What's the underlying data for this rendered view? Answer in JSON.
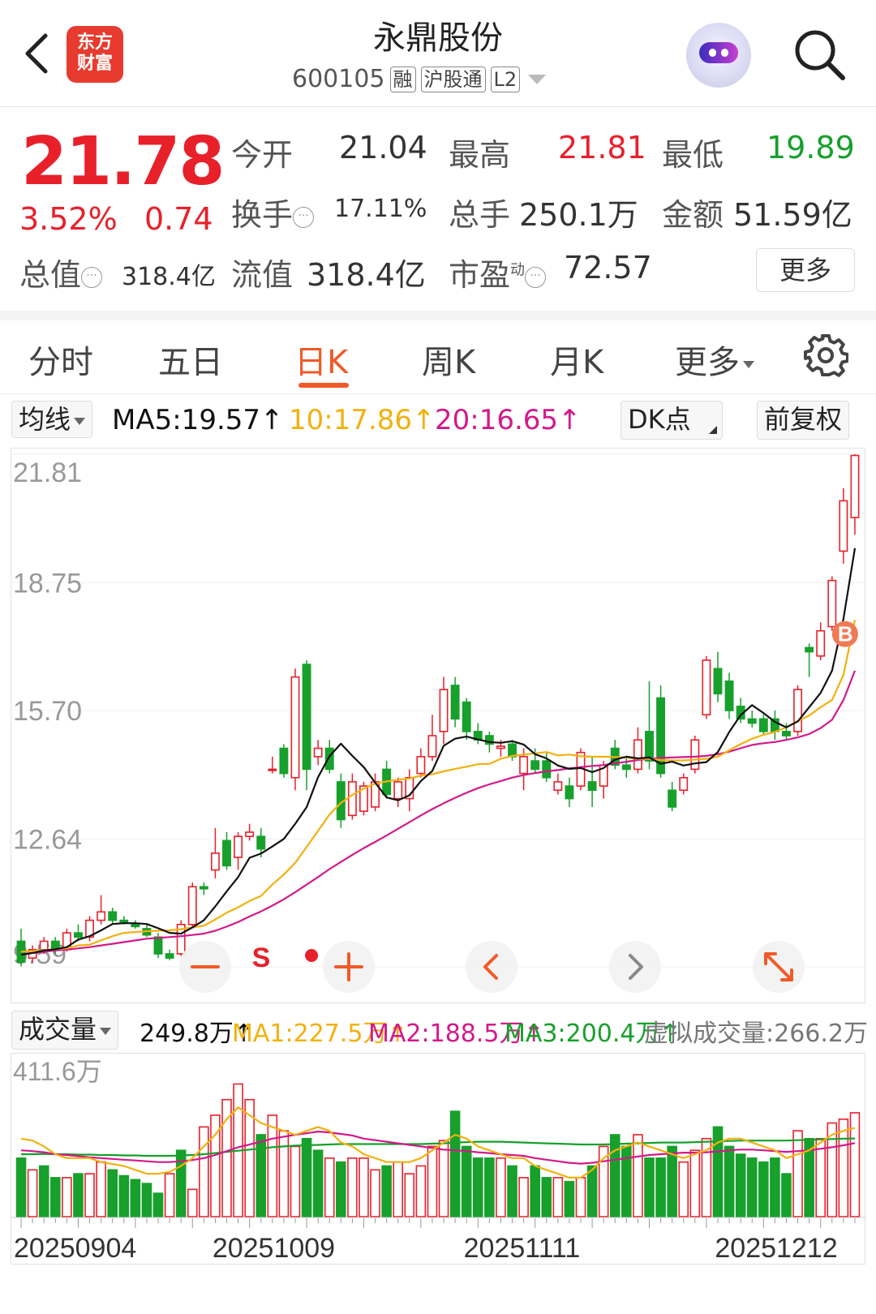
{
  "header": {
    "back_icon": "chevron-left-icon",
    "logo_line1": "东方",
    "logo_line2": "财富",
    "title": "永鼎股份",
    "code": "600105",
    "tags": [
      "融",
      "沪股通",
      "L2"
    ],
    "robot_icon": "robot-assistant-icon",
    "search_icon": "search-icon"
  },
  "quote": {
    "price": "21.78",
    "change_pct": "3.52%",
    "change_amt": "0.74",
    "open_label": "今开",
    "open": "21.04",
    "high_label": "最高",
    "high": "21.81",
    "low_label": "最低",
    "low": "19.89",
    "turnover_label": "换手",
    "turnover": "17.11%",
    "volume_label": "总手",
    "volume": "250.1万",
    "amount_label": "金额",
    "amount": "51.59亿",
    "mktcap_label": "总值",
    "mktcap": "318.4亿",
    "float_label": "流值",
    "float_cap": "318.4亿",
    "pe_label": "市盈",
    "pe_sup": "动",
    "pe": "72.57",
    "more_label": "更多"
  },
  "tabs": [
    "分时",
    "五日",
    "日K",
    "周K",
    "月K",
    "更多"
  ],
  "active_tab": "日K",
  "ma_bar": {
    "dropdown": "均线",
    "ma5": "MA5:19.57",
    "ma10": "10:17.86",
    "ma20": "20:16.65",
    "dk_label": "DK点",
    "adjust_label": "前复权"
  },
  "volume_bar": {
    "dropdown": "成交量",
    "vol": "249.8万",
    "ma1": "MA1:227.5万",
    "ma2": "MA2:188.5万",
    "ma3": "MA3:200.4万",
    "virtual": "虚拟成交量:266.2万"
  },
  "colors": {
    "up": "#e8202a",
    "down": "#17a02b",
    "ma5": "#111111",
    "ma10": "#f2b10f",
    "ma20": "#d21a8a",
    "accent": "#f05a28"
  },
  "controls": {
    "zoom_out_icon": "minus-icon",
    "zoom_in_icon": "plus-icon",
    "prev_icon": "chevron-left-icon",
    "next_icon": "chevron-right-icon",
    "fullscreen_icon": "expand-icon"
  },
  "chart_data": [
    {
      "type": "candlestick",
      "y_ticks": [
        "21.81",
        "18.75",
        "15.70",
        "12.64",
        "9.59"
      ],
      "ylim": [
        9.59,
        21.81
      ],
      "marker_s": "S",
      "marker_b": "B",
      "candles": [
        [
          10.2,
          10.5,
          9.6,
          9.7
        ],
        [
          9.8,
          10.1,
          9.7,
          10.0
        ],
        [
          10.0,
          10.3,
          9.9,
          10.2
        ],
        [
          10.2,
          10.3,
          9.9,
          10.0
        ],
        [
          10.0,
          10.5,
          9.95,
          10.4
        ],
        [
          10.4,
          10.6,
          10.2,
          10.3
        ],
        [
          10.3,
          10.8,
          10.2,
          10.7
        ],
        [
          10.7,
          11.3,
          10.6,
          10.9
        ],
        [
          10.9,
          11.0,
          10.6,
          10.7
        ],
        [
          10.7,
          10.8,
          10.6,
          10.65
        ],
        [
          10.6,
          10.7,
          10.5,
          10.55
        ],
        [
          10.5,
          10.6,
          10.3,
          10.35
        ],
        [
          10.3,
          10.4,
          9.8,
          9.9
        ],
        [
          9.9,
          10.0,
          9.75,
          9.8
        ],
        [
          9.9,
          10.7,
          9.85,
          10.6
        ],
        [
          10.6,
          11.6,
          10.55,
          11.5
        ],
        [
          11.5,
          11.6,
          11.3,
          11.45
        ],
        [
          11.9,
          12.9,
          11.7,
          12.3
        ],
        [
          12.6,
          12.8,
          11.9,
          12.0
        ],
        [
          12.2,
          12.8,
          11.9,
          12.7
        ],
        [
          12.7,
          13.0,
          12.6,
          12.8
        ],
        [
          12.7,
          12.9,
          12.2,
          12.4
        ],
        [
          14.3,
          14.6,
          14.2,
          14.3
        ],
        [
          14.8,
          14.9,
          14.1,
          14.2
        ],
        [
          14.1,
          16.7,
          13.8,
          16.5
        ],
        [
          16.8,
          16.9,
          13.8,
          14.3
        ],
        [
          14.6,
          15.0,
          14.4,
          14.8
        ],
        [
          14.8,
          15.0,
          14.2,
          14.3
        ],
        [
          14.0,
          14.2,
          12.9,
          13.1
        ],
        [
          13.2,
          14.2,
          13.1,
          14.0
        ],
        [
          13.3,
          14.0,
          13.2,
          13.9
        ],
        [
          13.4,
          14.2,
          13.3,
          14.0
        ],
        [
          14.3,
          14.5,
          13.6,
          13.7
        ],
        [
          13.6,
          14.1,
          13.4,
          14.0
        ],
        [
          13.6,
          14.3,
          13.3,
          14.1
        ],
        [
          14.2,
          14.8,
          14.1,
          14.6
        ],
        [
          14.6,
          15.6,
          14.5,
          15.1
        ],
        [
          15.2,
          16.5,
          14.9,
          16.2
        ],
        [
          16.3,
          16.5,
          15.3,
          15.5
        ],
        [
          15.9,
          16.0,
          15.0,
          15.2
        ],
        [
          15.2,
          15.4,
          14.9,
          15.0
        ],
        [
          15.1,
          15.2,
          14.7,
          14.9
        ],
        [
          14.8,
          15.0,
          14.6,
          14.85
        ],
        [
          14.9,
          15.0,
          14.5,
          14.6
        ],
        [
          14.2,
          14.8,
          13.8,
          14.6
        ],
        [
          14.5,
          14.8,
          14.2,
          14.3
        ],
        [
          14.5,
          14.7,
          14.0,
          14.1
        ],
        [
          13.8,
          14.2,
          13.7,
          14.0
        ],
        [
          13.9,
          14.1,
          13.4,
          13.6
        ],
        [
          13.9,
          14.8,
          13.8,
          14.7
        ],
        [
          14.0,
          14.6,
          13.4,
          13.8
        ],
        [
          13.9,
          14.5,
          13.6,
          14.4
        ],
        [
          14.8,
          15.0,
          14.3,
          14.4
        ],
        [
          14.4,
          14.6,
          14.1,
          14.3
        ],
        [
          14.3,
          15.3,
          14.2,
          15.0
        ],
        [
          15.2,
          16.4,
          14.3,
          14.5
        ],
        [
          16.0,
          16.3,
          14.1,
          14.2
        ],
        [
          13.8,
          14.0,
          13.3,
          13.4
        ],
        [
          13.8,
          14.2,
          13.7,
          14.1
        ],
        [
          14.3,
          15.1,
          14.2,
          15.0
        ],
        [
          15.6,
          17.0,
          15.5,
          16.9
        ],
        [
          16.7,
          17.1,
          15.9,
          16.1
        ],
        [
          16.4,
          16.6,
          15.5,
          15.7
        ],
        [
          15.8,
          16.0,
          15.4,
          15.5
        ],
        [
          15.5,
          15.7,
          15.3,
          15.4
        ],
        [
          15.5,
          15.6,
          15.1,
          15.2
        ],
        [
          15.5,
          15.7,
          15.0,
          15.2
        ],
        [
          15.2,
          15.4,
          15.0,
          15.1
        ],
        [
          15.2,
          16.3,
          15.1,
          16.2
        ],
        [
          17.2,
          17.3,
          16.5,
          17.1
        ],
        [
          17.0,
          17.8,
          16.9,
          17.6
        ],
        [
          17.7,
          18.9,
          17.6,
          18.8
        ],
        [
          19.5,
          21.0,
          19.2,
          20.7
        ],
        [
          20.3,
          21.81,
          19.89,
          21.78
        ]
      ],
      "ma5": [
        9.88,
        9.92,
        9.98,
        10.01,
        10.06,
        10.24,
        10.32,
        10.46,
        10.61,
        10.63,
        10.63,
        10.61,
        10.51,
        10.4,
        10.38,
        10.53,
        10.7,
        11.03,
        11.39,
        11.73,
        12.19,
        12.29,
        12.46,
        12.64,
        13.0,
        13.4,
        14.11,
        14.61,
        14.91,
        14.62,
        14.35,
        13.98,
        13.63,
        13.56,
        13.68,
        14.02,
        14.26,
        14.86,
        15.03,
        15.08,
        15.01,
        14.95,
        14.93,
        14.97,
        14.89,
        14.66,
        14.56,
        14.39,
        14.31,
        14.33,
        14.23,
        14.33,
        14.53,
        14.6,
        14.56,
        14.58,
        14.43,
        14.48,
        14.39,
        14.44,
        14.47,
        14.71,
        15.19,
        15.59,
        15.83,
        15.64,
        15.43,
        15.3,
        15.44,
        15.78,
        16.12,
        16.65,
        17.89,
        19.57
      ],
      "ma10": [
        9.95,
        9.97,
        9.99,
        10.01,
        10.03,
        10.1,
        10.12,
        10.22,
        10.32,
        10.4,
        10.42,
        10.44,
        10.45,
        10.46,
        10.49,
        10.53,
        10.57,
        10.72,
        10.88,
        11.01,
        11.16,
        11.28,
        11.55,
        11.79,
        12.07,
        12.45,
        12.83,
        13.22,
        13.5,
        13.69,
        13.84,
        13.96,
        14.01,
        14.05,
        14.08,
        14.15,
        14.18,
        14.25,
        14.31,
        14.36,
        14.42,
        14.43,
        14.55,
        14.62,
        14.65,
        14.68,
        14.71,
        14.63,
        14.65,
        14.61,
        14.6,
        14.6,
        14.59,
        14.58,
        14.55,
        14.55,
        14.52,
        14.51,
        14.51,
        14.53,
        14.55,
        14.6,
        14.75,
        14.9,
        15.03,
        15.12,
        15.19,
        15.3,
        15.45,
        15.58,
        15.78,
        15.95,
        16.55,
        17.86
      ],
      "ma20": [
        9.88,
        9.92,
        9.95,
        9.98,
        10.0,
        10.03,
        10.06,
        10.1,
        10.14,
        10.18,
        10.22,
        10.26,
        10.28,
        10.3,
        10.32,
        10.35,
        10.38,
        10.45,
        10.55,
        10.66,
        10.79,
        10.91,
        11.05,
        11.2,
        11.37,
        11.55,
        11.73,
        11.92,
        12.09,
        12.26,
        12.42,
        12.57,
        12.72,
        12.88,
        13.04,
        13.2,
        13.35,
        13.49,
        13.62,
        13.74,
        13.85,
        13.94,
        14.02,
        14.1,
        14.16,
        14.21,
        14.25,
        14.28,
        14.32,
        14.35,
        14.38,
        14.4,
        14.44,
        14.48,
        14.52,
        14.55,
        14.57,
        14.58,
        14.59,
        14.6,
        14.62,
        14.66,
        14.72,
        14.8,
        14.88,
        14.92,
        14.95,
        15.0,
        15.06,
        15.14,
        15.28,
        15.48,
        15.95,
        16.65
      ]
    },
    {
      "type": "bar",
      "unit": "万",
      "y_tick": "411.6万",
      "ylim": [
        0,
        411.6
      ],
      "x_labels": [
        "20250904",
        "20251009",
        "20251111",
        "20251212"
      ],
      "x_label_index": [
        0,
        22,
        44,
        66
      ],
      "volumes": [
        150,
        120,
        130,
        100,
        100,
        110,
        110,
        140,
        120,
        105,
        95,
        85,
        60,
        110,
        170,
        70,
        230,
        260,
        300,
        340,
        300,
        210,
        260,
        220,
        180,
        200,
        170,
        150,
        140,
        150,
        150,
        120,
        130,
        140,
        110,
        130,
        180,
        195,
        270,
        180,
        150,
        150,
        150,
        130,
        100,
        130,
        100,
        100,
        90,
        100,
        130,
        180,
        210,
        180,
        210,
        150,
        150,
        180,
        140,
        170,
        200,
        230,
        180,
        160,
        150,
        140,
        150,
        110,
        220,
        200,
        200,
        240,
        249.8,
        266.2
      ],
      "volume_up": [
        false,
        true,
        false,
        false,
        true,
        false,
        true,
        true,
        false,
        false,
        false,
        false,
        false,
        true,
        false,
        true,
        true,
        true,
        true,
        true,
        true,
        false,
        true,
        true,
        true,
        false,
        false,
        true,
        false,
        true,
        true,
        true,
        false,
        true,
        true,
        true,
        true,
        true,
        false,
        false,
        false,
        false,
        true,
        false,
        true,
        false,
        false,
        true,
        false,
        true,
        false,
        true,
        false,
        false,
        true,
        false,
        false,
        false,
        true,
        true,
        true,
        false,
        false,
        false,
        false,
        false,
        false,
        false,
        true,
        false,
        true,
        true,
        true,
        true
      ],
      "ma1": [
        200,
        195,
        180,
        160,
        150,
        150,
        150,
        140,
        135,
        130,
        120,
        110,
        110,
        115,
        130,
        150,
        180,
        210,
        250,
        280,
        260,
        240,
        230,
        220,
        210,
        220,
        230,
        220,
        190,
        180,
        160,
        150,
        140,
        140,
        140,
        150,
        170,
        190,
        210,
        200,
        180,
        170,
        160,
        150,
        150,
        130,
        120,
        110,
        100,
        100,
        120,
        150,
        170,
        180,
        190,
        180,
        170,
        160,
        150,
        160,
        170,
        190,
        200,
        200,
        190,
        180,
        170,
        150,
        160,
        170,
        190,
        210,
        220,
        227.5
      ],
      "ma2": [
        170,
        168,
        165,
        160,
        158,
        155,
        152,
        150,
        148,
        146,
        144,
        142,
        140,
        140,
        142,
        145,
        150,
        158,
        168,
        178,
        185,
        192,
        200,
        205,
        210,
        214,
        218,
        216,
        212,
        208,
        200,
        196,
        192,
        188,
        184,
        180,
        176,
        172,
        170,
        168,
        165,
        163,
        160,
        158,
        156,
        150,
        146,
        142,
        138,
        136,
        138,
        142,
        146,
        150,
        154,
        158,
        160,
        162,
        164,
        164,
        165,
        167,
        170,
        172,
        172,
        170,
        168,
        166,
        168,
        170,
        174,
        178,
        183,
        188.5
      ],
      "ma3": [
        160,
        160,
        161,
        160,
        160,
        159,
        159,
        158,
        158,
        157,
        157,
        156,
        156,
        156,
        157,
        158,
        160,
        163,
        166,
        169,
        172,
        175,
        178,
        180,
        182,
        183,
        184,
        185,
        186,
        186,
        186,
        186,
        186,
        186,
        186,
        186,
        187,
        188,
        190,
        191,
        192,
        192,
        192,
        191,
        190,
        189,
        188,
        187,
        186,
        185,
        185,
        185,
        186,
        187,
        188,
        189,
        190,
        190,
        190,
        191,
        192,
        193,
        194,
        195,
        195,
        195,
        195,
        195,
        196,
        197,
        198,
        199,
        200,
        200.4
      ]
    }
  ]
}
